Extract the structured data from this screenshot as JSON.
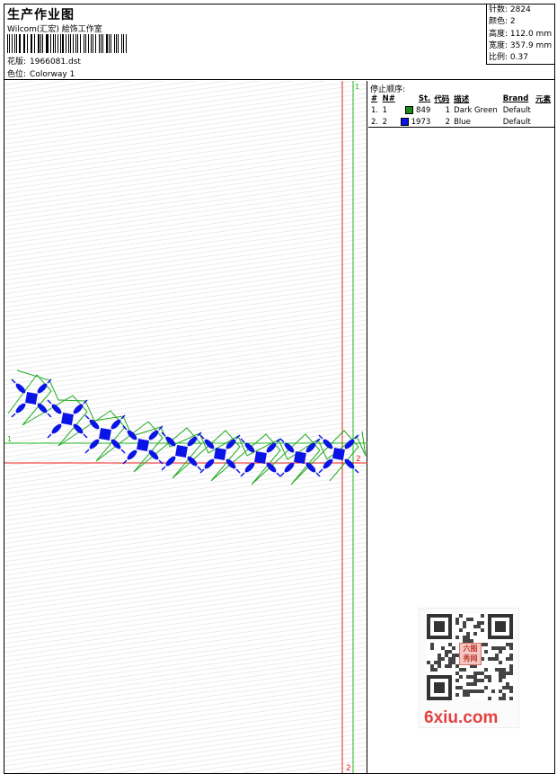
{
  "header": {
    "title": "生产作业图",
    "company": "Wilcom(汇宏) 絵饰工作室",
    "design_label": "花版:",
    "design_value": "1966081.dst",
    "colorway_label": "色位:",
    "colorway_value": "Colorway 1"
  },
  "stats": [
    {
      "label": "针数:",
      "value": "2824"
    },
    {
      "label": "颜色:",
      "value": "2"
    },
    {
      "label": "高度:",
      "value": "112.0 mm"
    },
    {
      "label": "宽度:",
      "value": "357.9 mm"
    },
    {
      "label": "比例:",
      "value": "0.37"
    }
  ],
  "stop_sequence": {
    "title": "停止顺序:",
    "columns": [
      "#",
      "N#",
      "St.",
      "代码",
      "描述",
      "Brand",
      "元素"
    ],
    "rows": [
      {
        "index": "1.",
        "n": "1",
        "st": "849",
        "code": "1",
        "desc": "Dark Green",
        "brand": "Default",
        "color": "#1a8a1a"
      },
      {
        "index": "2.",
        "n": "2",
        "st": "1973",
        "code": "2",
        "desc": "Blue",
        "brand": "Default",
        "color": "#0a14e6"
      }
    ]
  },
  "markers": {
    "green_label": "1",
    "red_label": "2",
    "green_color": "#22bb22",
    "red_color": "#ee2222"
  },
  "design": {
    "stitch_blue": "#0a14e6",
    "stitch_green": "#22aa22"
  },
  "qr": {
    "stamp_text": "六图秀网",
    "watermark": "6xiu.com"
  }
}
